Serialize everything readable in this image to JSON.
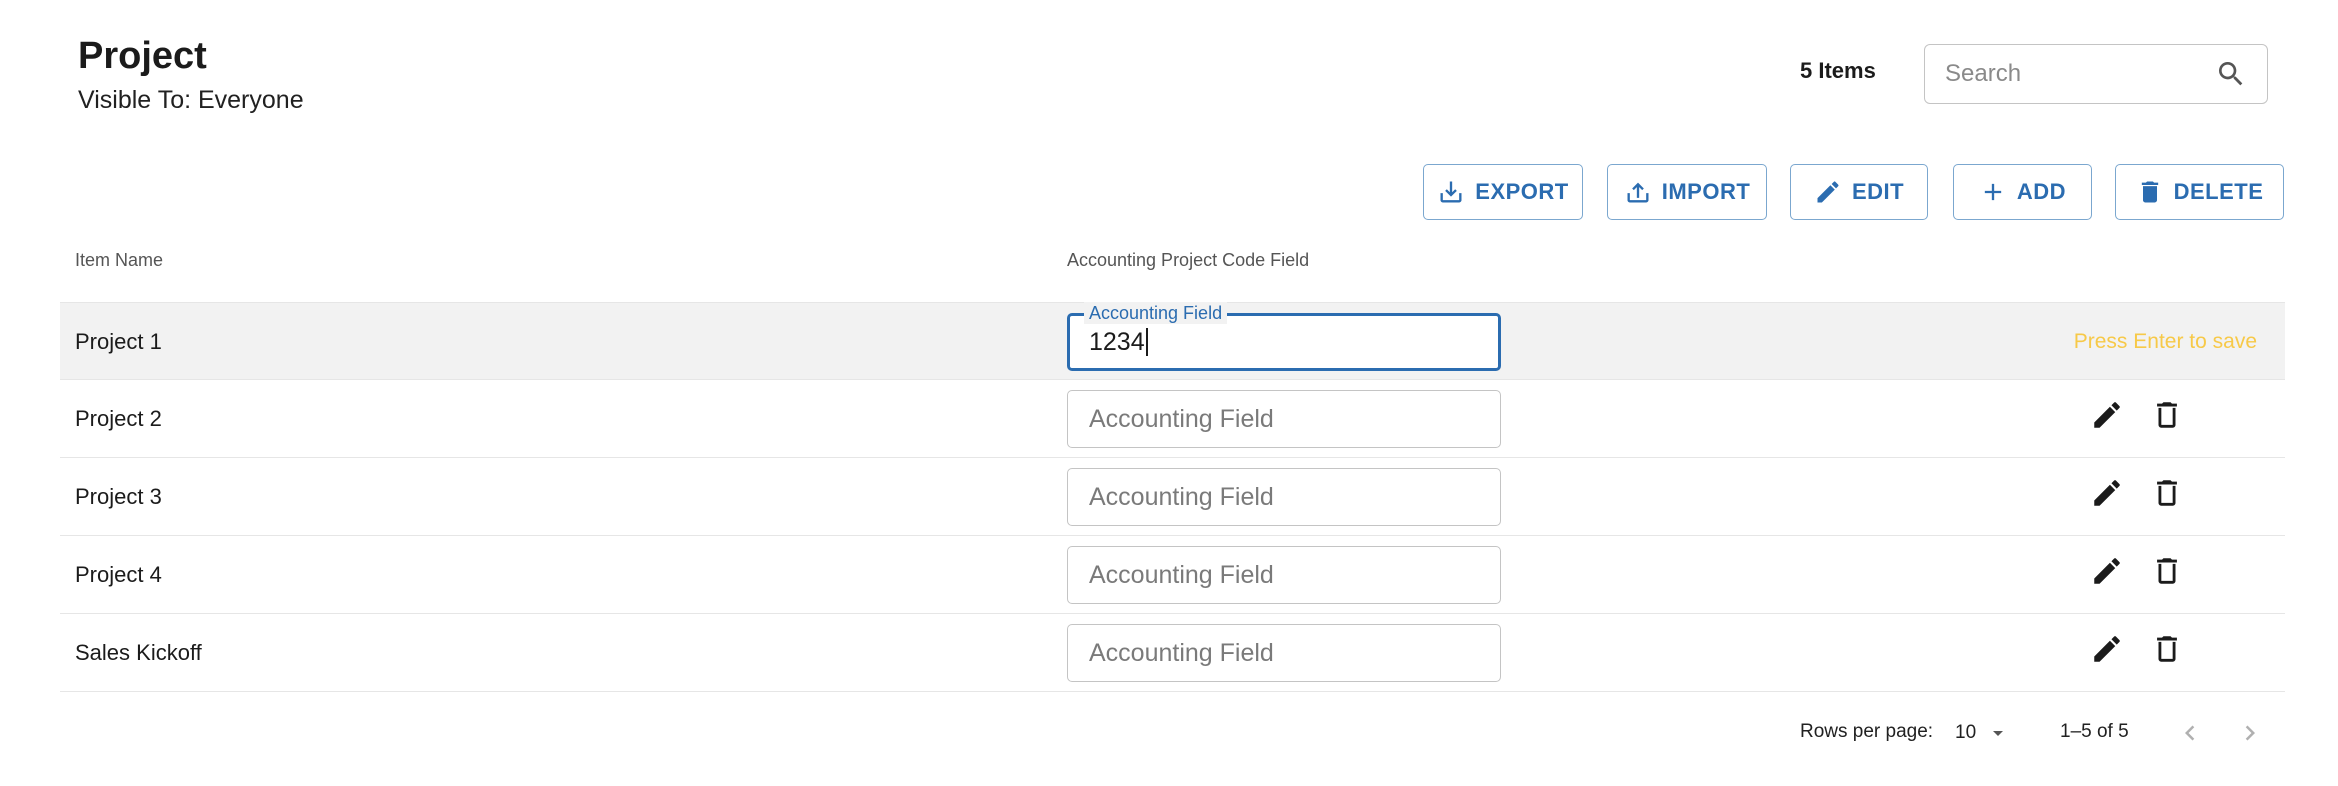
{
  "header": {
    "title": "Project",
    "subtitle": "Visible To: Everyone"
  },
  "items_count": "5 Items",
  "search": {
    "placeholder": "Search",
    "icon": "search-icon"
  },
  "toolbar": {
    "export_label": "EXPORT",
    "import_label": "IMPORT",
    "edit_label": "EDIT",
    "add_label": "ADD",
    "delete_label": "DELETE"
  },
  "table": {
    "columns": [
      "Item Name",
      "Accounting Project Code Field"
    ],
    "field_placeholder": "Accounting Field",
    "rows": [
      {
        "name": "Project 1",
        "value": "1234",
        "editing": true,
        "field_label": "Accounting Field",
        "hint": "Press Enter to save"
      },
      {
        "name": "Project 2",
        "value": ""
      },
      {
        "name": "Project 3",
        "value": ""
      },
      {
        "name": "Project 4",
        "value": ""
      },
      {
        "name": "Sales Kickoff",
        "value": ""
      }
    ]
  },
  "pagination": {
    "rows_per_page_label": "Rows per page:",
    "rows_per_page": "10",
    "range": "1–5 of 5"
  },
  "colors": {
    "accent": "#2b6cb0",
    "hint": "#f7c948",
    "row_active_bg": "#f2f2f2"
  }
}
